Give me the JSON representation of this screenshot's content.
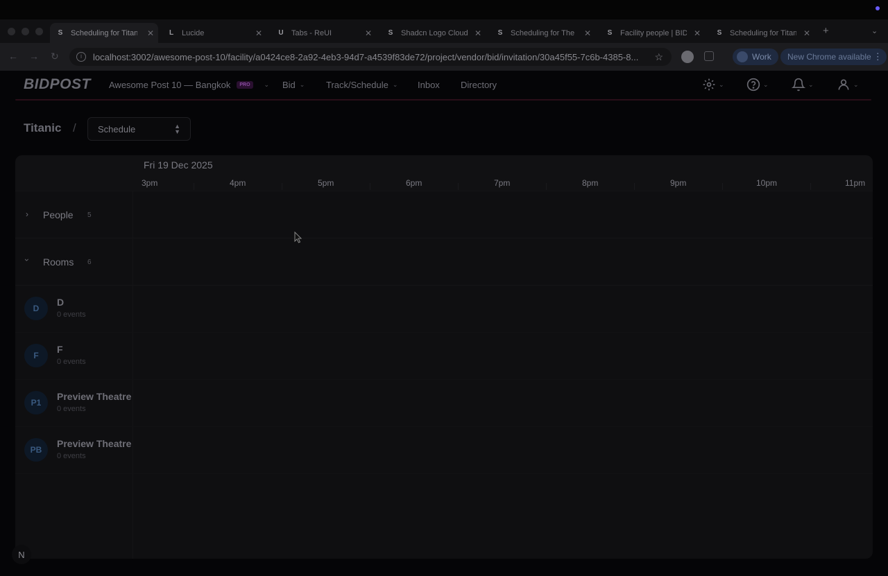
{
  "browser": {
    "tabs": [
      {
        "title": "Scheduling for Titanic",
        "favicon": "S",
        "active": true
      },
      {
        "title": "Lucide",
        "favicon": "L",
        "active": false
      },
      {
        "title": "Tabs - ReUI",
        "favicon": "U",
        "active": false
      },
      {
        "title": "Shadcn Logo Cloud",
        "favicon": "S",
        "active": false
      },
      {
        "title": "Scheduling for The",
        "favicon": "S",
        "active": false
      },
      {
        "title": "Facility people | BID",
        "favicon": "S",
        "active": false
      },
      {
        "title": "Scheduling for Titanic",
        "favicon": "S",
        "active": false
      }
    ],
    "url": "localhost:3002/awesome-post-10/facility/a0424ce8-2a92-4eb3-94d7-a4539f83de72/project/vendor/bid/invitation/30a45f55-7c6b-4385-8...",
    "profile_label": "Work",
    "update_label": "New Chrome available"
  },
  "app": {
    "logo": "BIDPOST",
    "workspace": "Awesome Post 10 — Bangkok",
    "workspace_badge": "PRO",
    "nav": [
      {
        "label": "Bid",
        "has_menu": true
      },
      {
        "label": "Track/Schedule",
        "has_menu": true
      },
      {
        "label": "Inbox",
        "has_menu": false
      },
      {
        "label": "Directory",
        "has_menu": false
      }
    ]
  },
  "breadcrumb": {
    "project": "Titanic",
    "separator": "/",
    "view_select": "Schedule"
  },
  "schedule": {
    "date": "Fri 19 Dec 2025",
    "hours": [
      "3pm",
      "4pm",
      "5pm",
      "6pm",
      "7pm",
      "8pm",
      "9pm",
      "10pm",
      "11pm"
    ],
    "groups": [
      {
        "label": "People",
        "count": "5",
        "expanded": false
      },
      {
        "label": "Rooms",
        "count": "6",
        "expanded": true
      }
    ],
    "rooms": [
      {
        "initials": "D",
        "name": "D",
        "events": "0 events"
      },
      {
        "initials": "F",
        "name": "F",
        "events": "0 events"
      },
      {
        "initials": "P1",
        "name": "Preview Theatre",
        "events": "0 events"
      },
      {
        "initials": "PB",
        "name": "Preview Theatre",
        "events": "0 events"
      }
    ]
  },
  "dev_badge": "N"
}
